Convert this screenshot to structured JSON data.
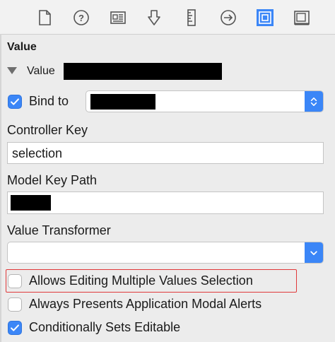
{
  "toolbar": {
    "icons": [
      "file-inspector-icon",
      "quick-help-icon",
      "identity-inspector-icon",
      "attributes-inspector-icon",
      "size-inspector-icon",
      "connections-inspector-icon",
      "bindings-inspector-icon",
      "view-effects-icon"
    ],
    "active_icon": "bindings-inspector-icon",
    "accent_color": "#3b86f7"
  },
  "section": {
    "title": "Value"
  },
  "value_row": {
    "label": "Value"
  },
  "bind": {
    "label": "Bind to",
    "checked": true
  },
  "controller_key": {
    "label": "Controller Key",
    "value": "selection"
  },
  "model_key_path": {
    "label": "Model Key Path"
  },
  "value_transformer": {
    "label": "Value Transformer",
    "value": ""
  },
  "options": [
    {
      "label": "Allows Editing Multiple Values Selection",
      "checked": false
    },
    {
      "label": "Always Presents Application Modal Alerts",
      "checked": false
    },
    {
      "label": "Conditionally Sets Editable",
      "checked": true
    }
  ]
}
